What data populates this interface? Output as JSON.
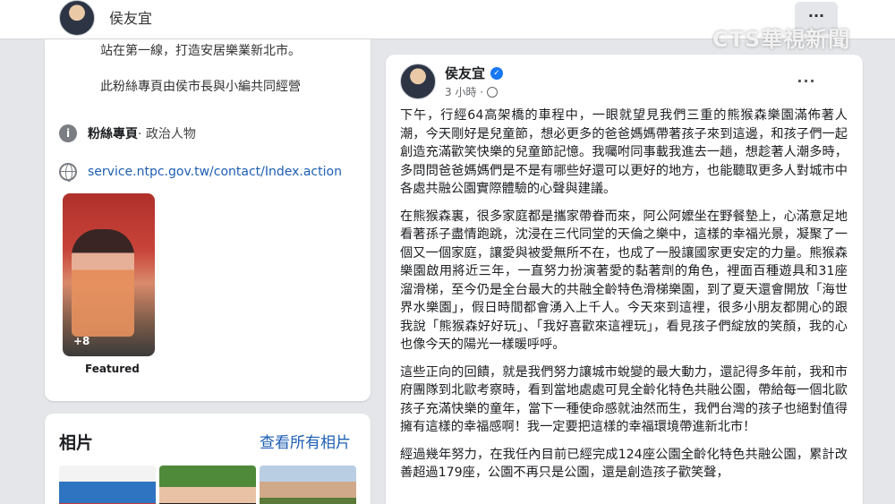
{
  "header": {
    "page_name": "侯友宜",
    "more_label": "···",
    "watermark": "CTS華視新聞"
  },
  "intro": {
    "line1": "站在第一線，打造安居樂業新北市。",
    "line2": "此粉絲專頁由侯市長與小編共同經營",
    "category_label": "粉絲專頁",
    "category_value": "· 政治人物",
    "website": "service.ntpc.gov.tw/contact/Index.action",
    "featured_count": "+8",
    "featured_label": "Featured"
  },
  "photos": {
    "title": "相片",
    "see_all": "查看所有相片"
  },
  "post": {
    "author": "侯友宜",
    "time": "3 小時 ·",
    "more": "···",
    "paragraphs": [
      "下午，行經64高架橋的車程中，一眼就望見我們三重的熊猴森樂園滿佈著人潮，今天剛好是兒童節，想必更多的爸爸媽媽帶著孩子來到這邊，和孩子們一起創造充滿歡笑快樂的兒童節記憶。我囑咐同事載我進去一趟，想趁著人潮多時，多問問爸爸媽媽們是不是有哪些好還可以更好的地方，也能聽取更多人對城市中各處共融公園實際體驗的心聲與建議。",
      "在熊猴森裏，很多家庭都是攜家帶眷而來，阿公阿嬤坐在野餐墊上，心滿意足地看著孫子盡情跑跳，沈浸在三代同堂的天倫之樂中，這樣的幸福光景，凝聚了一個又一個家庭，讓愛與被愛無所不在，也成了一股讓國家更安定的力量。熊猴森樂園啟用將近三年，一直努力扮演著愛的黏著劑的角色，裡面百種遊具和31座溜滑梯，至今仍是全台最大的共融全齡特色滑梯樂園，到了夏天還會開放「海世界水樂園」，假日時間都會湧入上千人。今天來到這裡，很多小朋友都開心的跟我說「熊猴森好好玩」、「我好喜歡來這裡玩」，看見孩子們綻放的笑顏，我的心也像今天的陽光一樣暖呼呼。",
      "這些正向的回饋，就是我們努力讓城市蛻變的最大動力，還記得多年前，我和市府團隊到北歐考察時，看到當地處處可見全齡化特色共融公園，帶給每一個北歐孩子充滿快樂的童年，當下一種使命感就油然而生，我們台灣的孩子也絕對值得擁有這樣的幸福感啊！我一定要把這樣的幸福環境帶進新北市！",
      "經過幾年努力，在我任內目前已經完成124座公園全齡化特色共融公園，累計改善超過179座，公園不再只是公園，還是創造孩子歡笑聲，"
    ]
  }
}
